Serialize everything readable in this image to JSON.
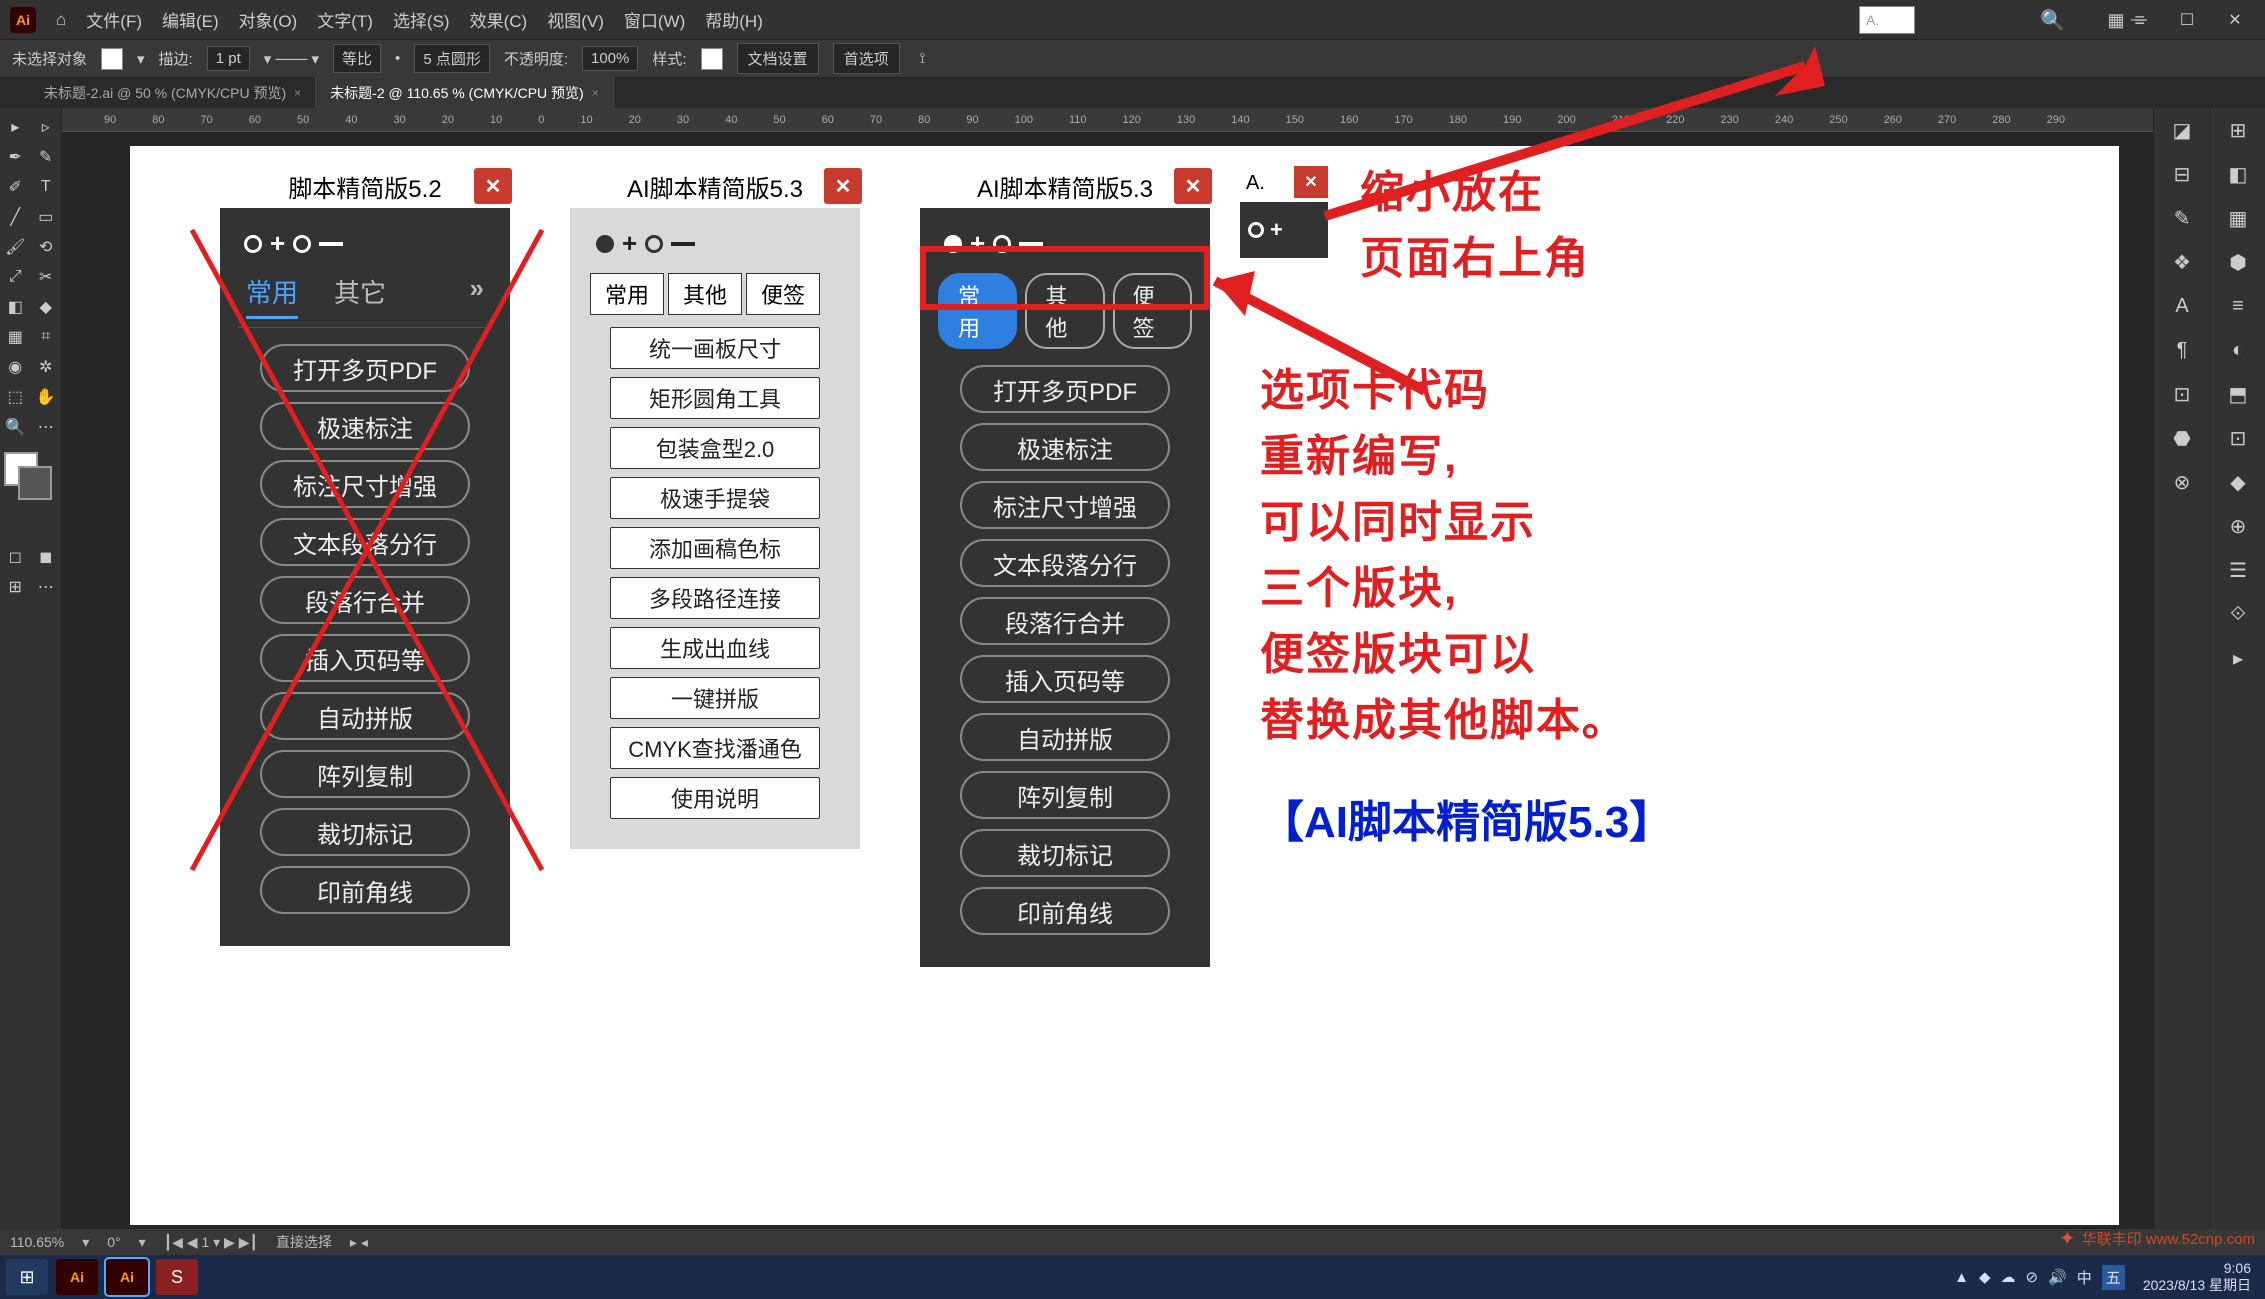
{
  "menubar": {
    "items": [
      "文件(F)",
      "编辑(E)",
      "对象(O)",
      "文字(T)",
      "选择(S)",
      "效果(C)",
      "视图(V)",
      "窗口(W)",
      "帮助(H)"
    ]
  },
  "topinput_value": "A.",
  "optbar": {
    "label_noselect": "未选择对象",
    "stroke_label": "描边:",
    "stroke_val": "1 pt",
    "uniform": "等比",
    "pts": "5 点圆形",
    "opacity_label": "不透明度:",
    "opacity_val": "100%",
    "style_label": "样式:",
    "docset": "文档设置",
    "prefs": "首选项"
  },
  "doctabs": {
    "tab1": "未标题-2.ai @ 50 % (CMYK/CPU 预览)",
    "tab2": "未标题-2 @ 110.65 % (CMYK/CPU 预览)"
  },
  "ruler_marks": [
    "90",
    "80",
    "70",
    "60",
    "50",
    "40",
    "30",
    "20",
    "10",
    "0",
    "10",
    "20",
    "30",
    "40",
    "50",
    "60",
    "70",
    "80",
    "90",
    "100",
    "110",
    "120",
    "130",
    "140",
    "150",
    "160",
    "170",
    "180",
    "190",
    "200",
    "210",
    "220",
    "230",
    "240",
    "250",
    "260",
    "270",
    "280",
    "290"
  ],
  "panel1": {
    "title": "脚本精简版5.2",
    "tabs": [
      "常用",
      "其它"
    ],
    "buttons": [
      "打开多页PDF",
      "极速标注",
      "标注尺寸增强",
      "文本段落分行",
      "段落行合并",
      "插入页码等",
      "自动拼版",
      "阵列复制",
      "裁切标记",
      "印前角线"
    ]
  },
  "panel2": {
    "title": "AI脚本精简版5.3",
    "tabs": [
      "常用",
      "其他",
      "便签"
    ],
    "buttons": [
      "统一画板尺寸",
      "矩形圆角工具",
      "包装盒型2.0",
      "极速手提袋",
      "添加画稿色标",
      "多段路径连接",
      "生成出血线",
      "一键拼版",
      "CMYK查找潘通色",
      "使用说明"
    ]
  },
  "panel3": {
    "title": "AI脚本精简版5.3",
    "tabs": [
      "常用",
      "其他",
      "便签"
    ],
    "buttons": [
      "打开多页PDF",
      "极速标注",
      "标注尺寸增强",
      "文本段落分行",
      "段落行合并",
      "插入页码等",
      "自动拼版",
      "阵列复制",
      "裁切标记",
      "印前角线"
    ]
  },
  "panel_mini": {
    "title": "A."
  },
  "anno1_line1": "缩小放在",
  "anno1_line2": "页面右上角",
  "anno2_l1": "选项卡代码",
  "anno2_l2": "重新编写,",
  "anno2_l3": "可以同时显示",
  "anno2_l4": "三个版块,",
  "anno2_l5": "便签版块可以",
  "anno2_l6": "替换成其他脚本｡",
  "anno_blue": "【AI脚本精简版5.3】",
  "status": {
    "zoom": "110.65%",
    "angle": "0°",
    "art": "1",
    "tool": "直接选择"
  },
  "taskbar": {
    "clock_time": "9:06",
    "clock_date": "2023/8/13 星期日"
  },
  "watermark": "华联丰印 www.52cnp.com"
}
